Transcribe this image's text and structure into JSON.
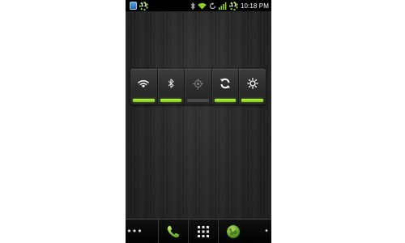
{
  "status_bar": {
    "time": "10:18 PM",
    "notification_badge": "11",
    "signal_badge": "11",
    "icons": [
      "app-notification-icon",
      "bluetooth-icon",
      "wifi-icon",
      "sync-icon",
      "signal-icon",
      "battery-icon"
    ]
  },
  "power_widget": {
    "toggles": [
      {
        "name": "wifi",
        "icon": "wifi-icon",
        "on": true
      },
      {
        "name": "bluetooth",
        "icon": "bluetooth-icon",
        "on": true
      },
      {
        "name": "gps",
        "icon": "gps-icon",
        "on": false
      },
      {
        "name": "sync",
        "icon": "sync-icon",
        "on": true
      },
      {
        "name": "brightness",
        "icon": "brightness-icon",
        "on": true
      }
    ],
    "accent_color": "#8ed226"
  },
  "dock": {
    "left_dots": "•••",
    "right_dot": "•",
    "items": [
      "phone-icon",
      "app-drawer-icon",
      "browser-icon"
    ]
  }
}
